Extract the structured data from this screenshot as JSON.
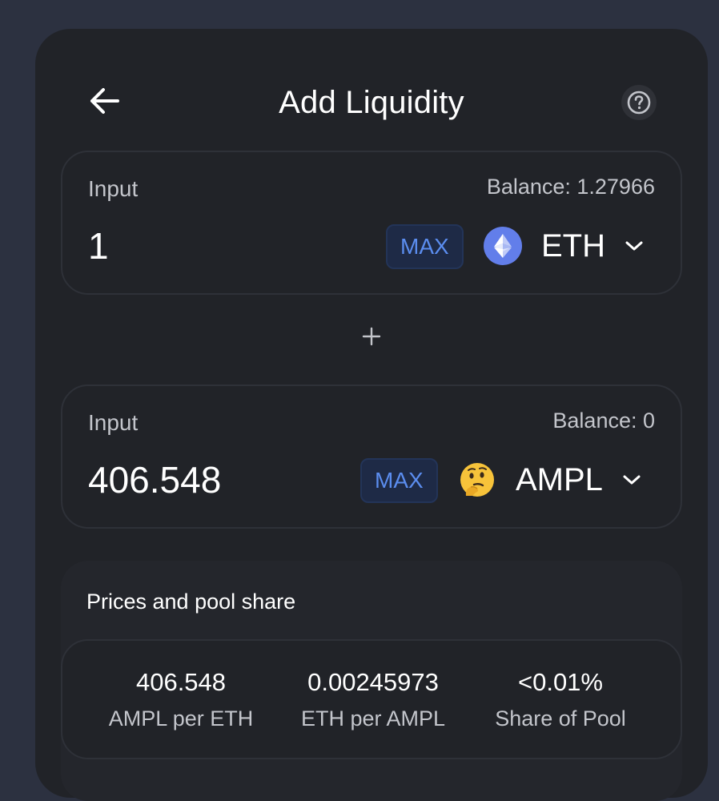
{
  "header": {
    "title": "Add Liquidity"
  },
  "inputs": [
    {
      "label": "Input",
      "balance": "Balance: 1.27966",
      "amount": "1",
      "max_label": "MAX",
      "token": "ETH",
      "token_icon": "ethereum-icon"
    },
    {
      "label": "Input",
      "balance": "Balance: 0",
      "amount": "406.548",
      "max_label": "MAX",
      "token": "AMPL",
      "token_icon": "thinking-face-icon"
    }
  ],
  "prices": {
    "title": "Prices and pool share",
    "stats": [
      {
        "value": "406.548",
        "label": "AMPL per ETH"
      },
      {
        "value": "0.00245973",
        "label": "ETH per AMPL"
      },
      {
        "value": "<0.01%",
        "label": "Share of Pool"
      }
    ]
  },
  "colors": {
    "background": "#2c3140",
    "card": "#212328",
    "accent": "#5b8def",
    "max_bg": "#1e2a46"
  }
}
